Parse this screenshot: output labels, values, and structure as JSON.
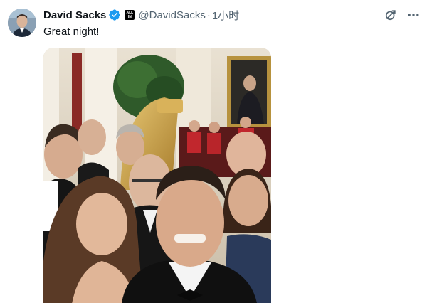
{
  "tweet": {
    "author": {
      "display_name": "David Sacks",
      "handle": "@DavidSacks",
      "verified_icon": "verified-badge-icon",
      "affiliate_label_line1": "ALL",
      "affiliate_label_line2": "IN"
    },
    "separator": "·",
    "time": "1小时",
    "text": "Great night!",
    "media": {
      "type": "photo",
      "description": "selfie-photo"
    }
  },
  "icons": {
    "grok": "grok-icon",
    "more": "more-icon"
  },
  "colors": {
    "verified": "#1d9bf0",
    "secondary_text": "#536471",
    "primary_text": "#0f1419"
  }
}
